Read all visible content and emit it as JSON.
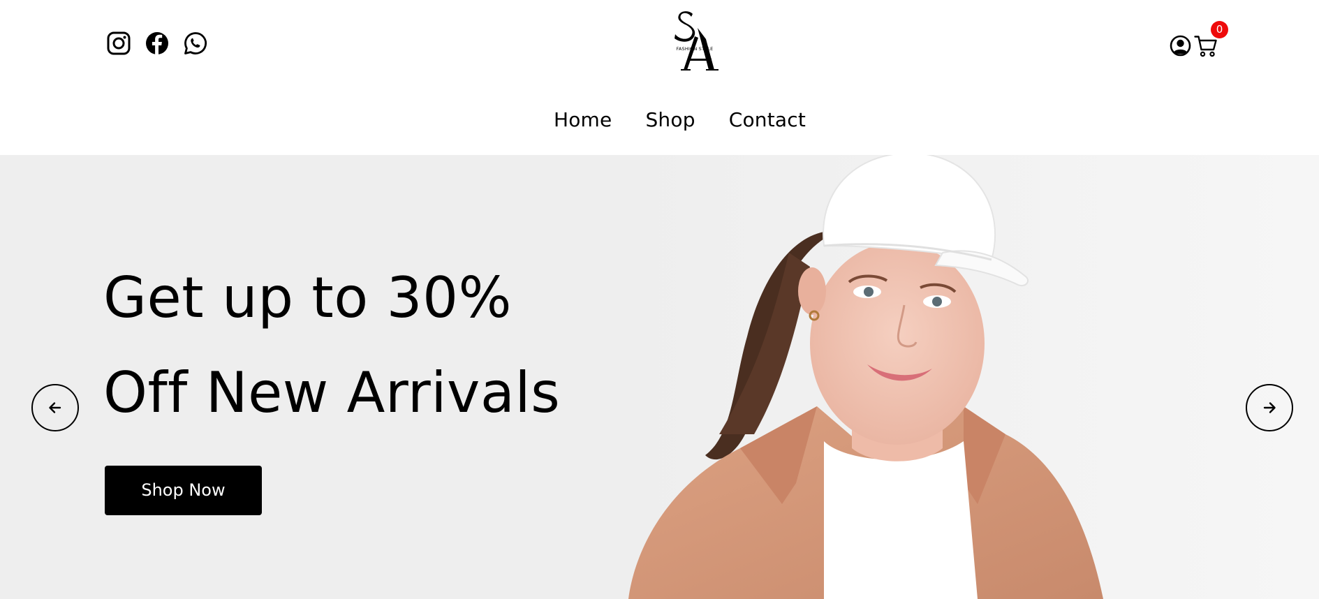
{
  "header": {
    "socials": [
      {
        "name": "instagram",
        "icon": "instagram-icon"
      },
      {
        "name": "facebook",
        "icon": "facebook-icon"
      },
      {
        "name": "whatsapp",
        "icon": "whatsapp-icon"
      }
    ],
    "logo": {
      "monogram_top": "S",
      "monogram_bottom": "A",
      "tagline": "FASHION STYLE"
    },
    "account_icon": "user-circle-icon",
    "cart": {
      "icon": "shopping-cart-icon",
      "count": "0",
      "badge_color": "#ee0a0a"
    }
  },
  "nav": {
    "items": [
      "Home",
      "Shop",
      "Contact"
    ]
  },
  "hero": {
    "headline_line1": "Get up to 30%",
    "headline_line2": "Off New Arrivals",
    "cta_label": "Shop Now",
    "prev_icon": "arrow-left-icon",
    "next_icon": "arrow-right-icon",
    "background_color": "#eeeeee"
  }
}
